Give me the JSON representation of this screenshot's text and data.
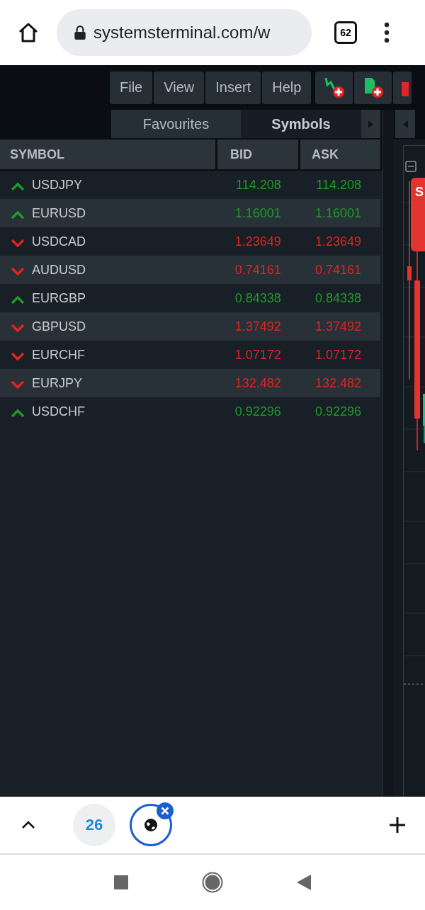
{
  "browser": {
    "url": "systemsterminal.com/w",
    "tab_count": "62"
  },
  "menu": [
    "File",
    "View",
    "Insert",
    "Help"
  ],
  "tabs": [
    {
      "label": "Favourites",
      "selected": false
    },
    {
      "label": "Symbols",
      "selected": true
    }
  ],
  "table": {
    "columns": [
      "SYMBOL",
      "BID",
      "ASK"
    ],
    "rows": [
      {
        "symbol": "USDJPY",
        "kind": "up",
        "bid": "114.208",
        "ask": "114.208"
      },
      {
        "symbol": "EURUSD",
        "kind": "up",
        "bid": "1.16001",
        "ask": "1.16001"
      },
      {
        "symbol": "USDCAD",
        "kind": "down",
        "bid": "1.23649",
        "ask": "1.23649"
      },
      {
        "symbol": "AUDUSD",
        "kind": "down",
        "bid": "0.74161",
        "ask": "0.74161"
      },
      {
        "symbol": "EURGBP",
        "kind": "up",
        "bid": "0.84338",
        "ask": "0.84338"
      },
      {
        "symbol": "GBPUSD",
        "kind": "down",
        "bid": "1.37492",
        "ask": "1.37492"
      },
      {
        "symbol": "EURCHF",
        "kind": "down",
        "bid": "1.07172",
        "ask": "1.07172"
      },
      {
        "symbol": "EURJPY",
        "kind": "down",
        "bid": "132.482",
        "ask": "132.482"
      },
      {
        "symbol": "USDCHF",
        "kind": "up",
        "bid": "0.92296",
        "ask": "0.92296"
      }
    ]
  },
  "chart": {
    "tag": "S"
  },
  "tab_strip": {
    "favicon_text": "26"
  }
}
